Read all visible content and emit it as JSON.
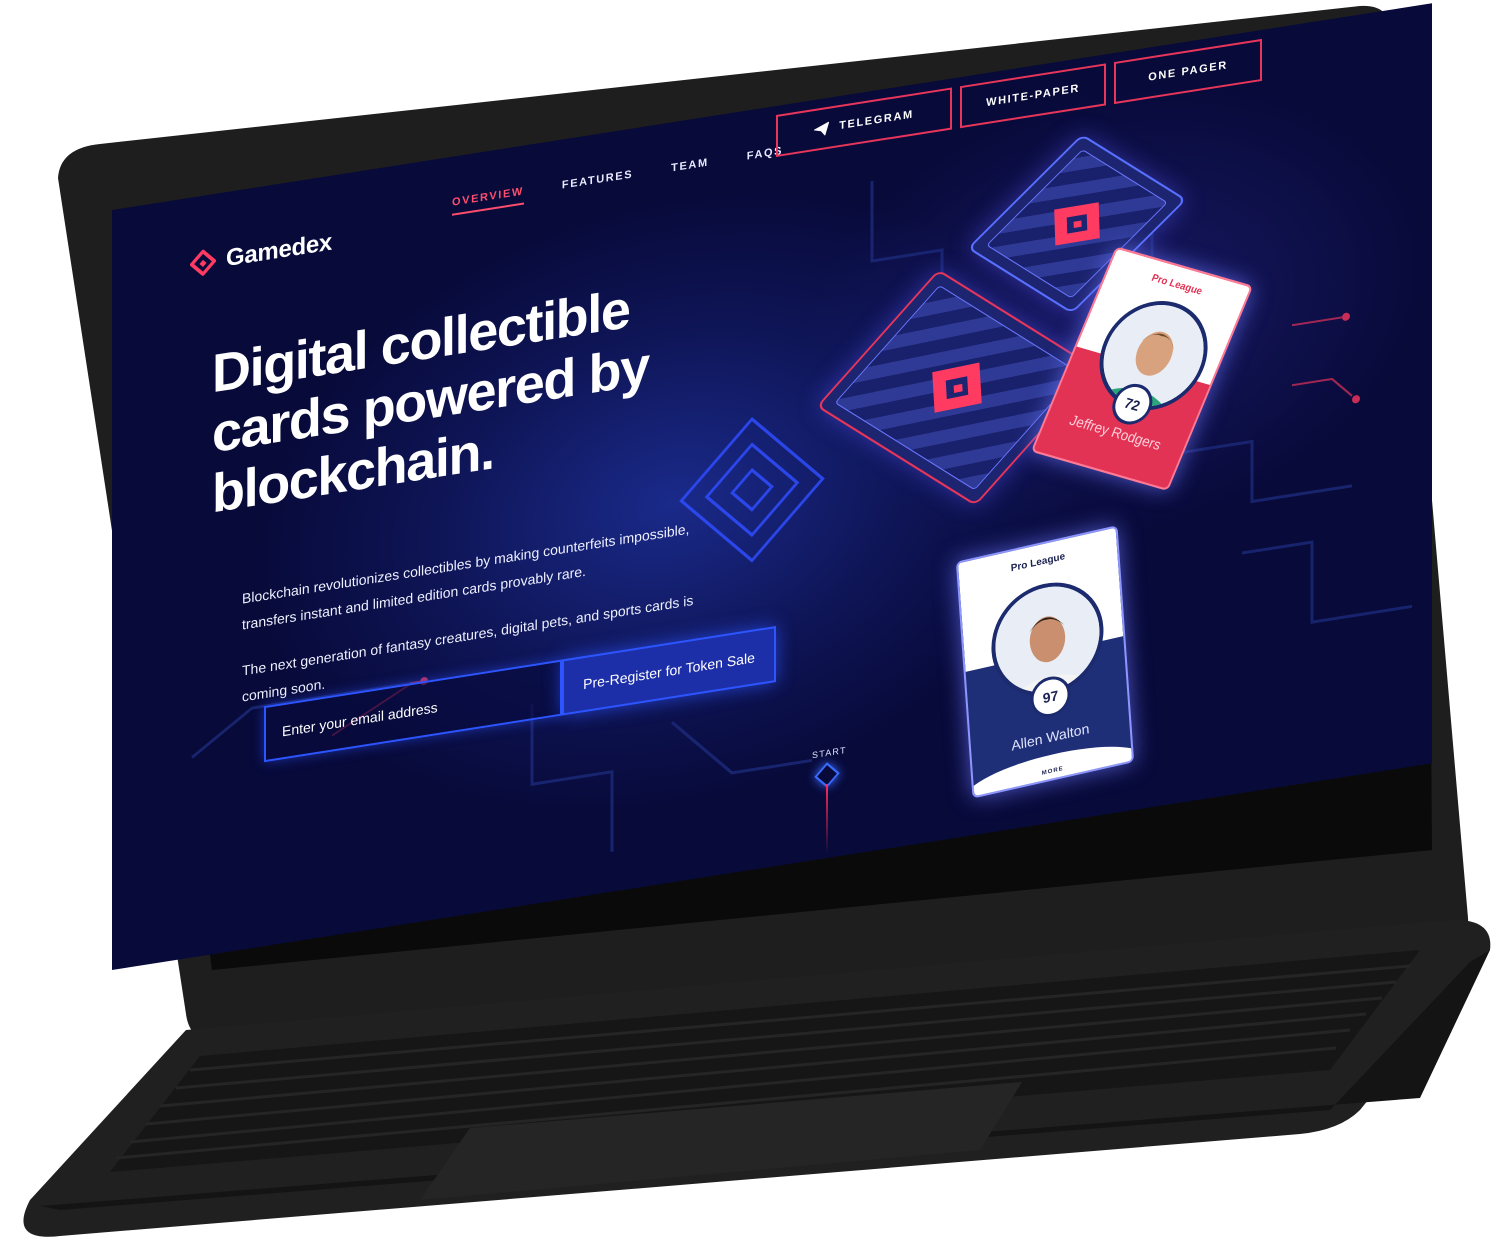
{
  "brand": {
    "name": "Gamedex",
    "logo_icon": "gamedex-logo-icon"
  },
  "nav": {
    "items": [
      {
        "label": "OVERVIEW",
        "active": true
      },
      {
        "label": "FEATURES",
        "active": false
      },
      {
        "label": "TEAM",
        "active": false
      },
      {
        "label": "FAQS",
        "active": false
      }
    ],
    "buttons": [
      {
        "label": "TELEGRAM",
        "icon": "paper-plane-icon"
      },
      {
        "label": "WHITE-PAPER"
      },
      {
        "label": "ONE PAGER"
      }
    ]
  },
  "hero": {
    "title": "Digital collectible cards powered by blockchain.",
    "paragraph_1": "Blockchain revolutionizes collectibles by making counterfeits impossible, transfers instant and limited edition cards provably rare.",
    "paragraph_2": "The next generation of fantasy creatures, digital pets, and sports cards is coming soon.",
    "email_placeholder": "Enter your email address",
    "register_label": "Pre-Register for Token Sale",
    "start_label": "START"
  },
  "cards": {
    "red_card": {
      "league": "Pro League",
      "rating": "72",
      "name": "Jeffrey Rodgers"
    },
    "white_card": {
      "league": "Pro League",
      "rating": "97",
      "name": "Allen Walton",
      "more": "MORE"
    }
  },
  "colors": {
    "background": "#080a3a",
    "accent_red": "#e8355a",
    "accent_blue": "#2d55ff",
    "laptop": "#1c1c1c"
  }
}
